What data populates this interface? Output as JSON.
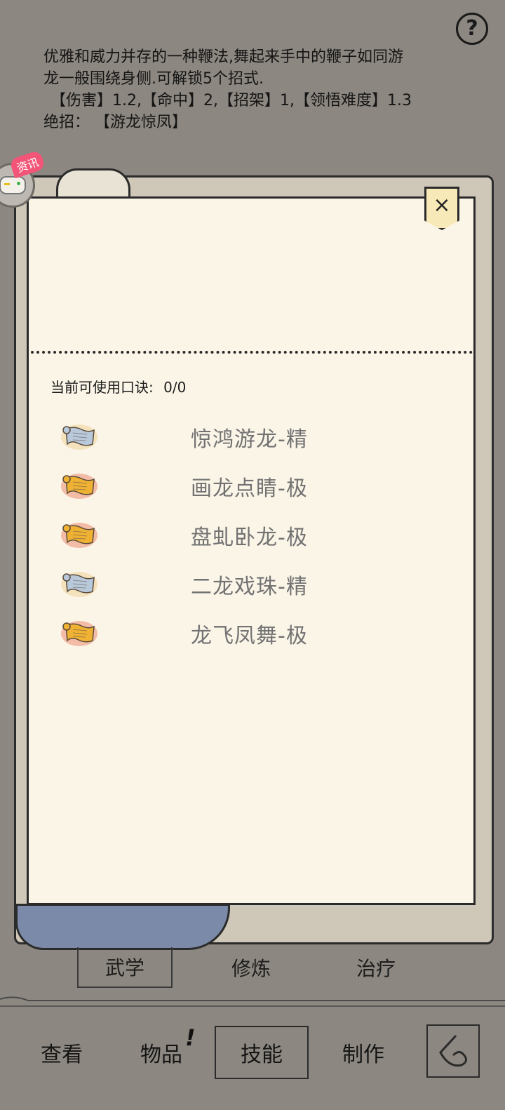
{
  "help": {
    "label": "?"
  },
  "description": {
    "line1": "优雅和威力并存的一种鞭法,舞起来手中的鞭子如同游",
    "line2": "龙一般围绕身侧.可解锁5个招式.",
    "stats": "【伤害】1.2,【命中】2,【招架】1,【领悟难度】1.3",
    "ultimate": "绝招：  【游龙惊凤】"
  },
  "news": {
    "tag": "资讯"
  },
  "panel": {
    "close_label": "×",
    "count_label": "当前可使用口诀:",
    "count_value": "0/0"
  },
  "skills": [
    {
      "name": "惊鸿游龙-精",
      "icon": "scroll-blue-icon",
      "color": "#b9c9dc"
    },
    {
      "name": "画龙点睛-极",
      "icon": "scroll-gold-icon",
      "color": "#f0b233"
    },
    {
      "name": "盘虬卧龙-极",
      "icon": "scroll-gold-icon",
      "color": "#f0b233"
    },
    {
      "name": "二龙戏珠-精",
      "icon": "scroll-blue-icon",
      "color": "#b9c9dc"
    },
    {
      "name": "龙飞凤舞-极",
      "icon": "scroll-gold-icon",
      "color": "#f0b233"
    }
  ],
  "subtabs": [
    {
      "label": "武学",
      "active": true
    },
    {
      "label": "修炼",
      "active": false
    },
    {
      "label": "治疗",
      "active": false
    }
  ],
  "nav": [
    {
      "label": "查看",
      "active": false
    },
    {
      "label": "物品",
      "active": false,
      "mark": "!"
    },
    {
      "label": "技能",
      "active": true
    },
    {
      "label": "制作",
      "active": false
    }
  ]
}
